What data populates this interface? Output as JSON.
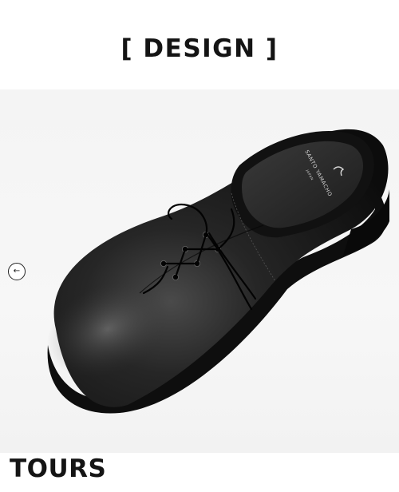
{
  "design": {
    "heading": "[ DESIGN ]"
  },
  "hero": {
    "image_subject": "black leather plain-toe derby shoe",
    "insole_brand": "SANTO YAMACHO",
    "insole_sub": "JAPAN",
    "prev_icon": "arrow-left-icon",
    "prev_glyph": "←"
  },
  "tours": {
    "heading": "TOURS"
  }
}
